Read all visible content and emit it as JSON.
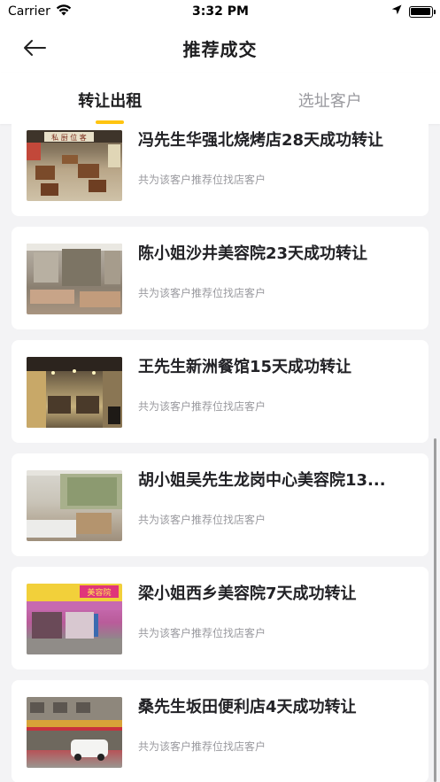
{
  "status_bar": {
    "carrier": "Carrier",
    "time": "3:32 PM"
  },
  "nav": {
    "title": "推荐成交"
  },
  "tabs": [
    {
      "label": "转让出租",
      "active": true
    },
    {
      "label": "选址客户",
      "active": false
    }
  ],
  "accent_color": "#ffc410",
  "list": [
    {
      "title": "冯先生华强北烧烤店28天成功转让",
      "subtitle": "共为该客户推荐位找店客户"
    },
    {
      "title": "陈小姐沙井美容院23天成功转让",
      "subtitle": "共为该客户推荐位找店客户"
    },
    {
      "title": "王先生新洲餐馆15天成功转让",
      "subtitle": "共为该客户推荐位找店客户"
    },
    {
      "title": "胡小姐吴先生龙岗中心美容院13...",
      "subtitle": "共为该客户推荐位找店客户"
    },
    {
      "title": "梁小姐西乡美容院7天成功转让",
      "subtitle": "共为该客户推荐位找店客户"
    },
    {
      "title": "桑先生坂田便利店4天成功转让",
      "subtitle": "共为该客户推荐位找店客户"
    }
  ],
  "thumb_texts": {
    "sign1": "私 厨 位 客",
    "sign5": "美容院"
  }
}
